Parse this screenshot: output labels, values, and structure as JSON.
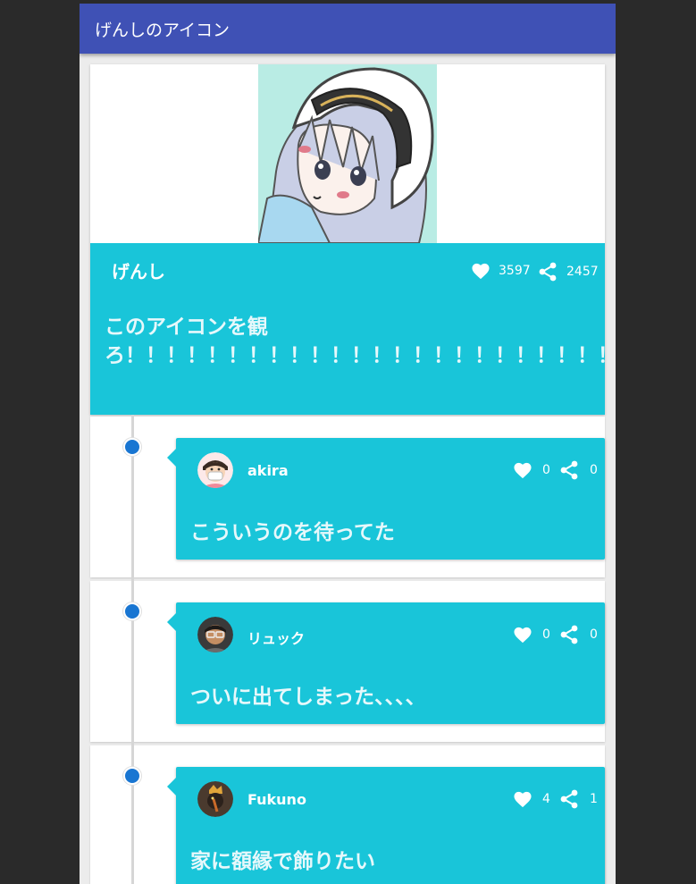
{
  "appbar": {
    "title": "げんしのアイコン"
  },
  "post": {
    "author": "げんし",
    "likes": "3597",
    "shares": "2457",
    "body": "このアイコンを観ろ！！！！！！！！！！！！！！！！！！！！！！！！！！！！！！"
  },
  "comments": [
    {
      "author": "akira",
      "likes": "0",
      "shares": "0",
      "body": "こういうのを待ってた"
    },
    {
      "author": "リュック",
      "likes": "0",
      "shares": "0",
      "body": "ついに出てしまった、、、、"
    },
    {
      "author": "Fukuno",
      "likes": "4",
      "shares": "1",
      "body": "家に額縁で飾りたい"
    }
  ],
  "colors": {
    "appbar": "#3f51b5",
    "card_accent": "#19c5d9",
    "timeline_dot": "#1976d2"
  },
  "icons": {
    "like": "heart-icon",
    "share": "share-icon"
  }
}
